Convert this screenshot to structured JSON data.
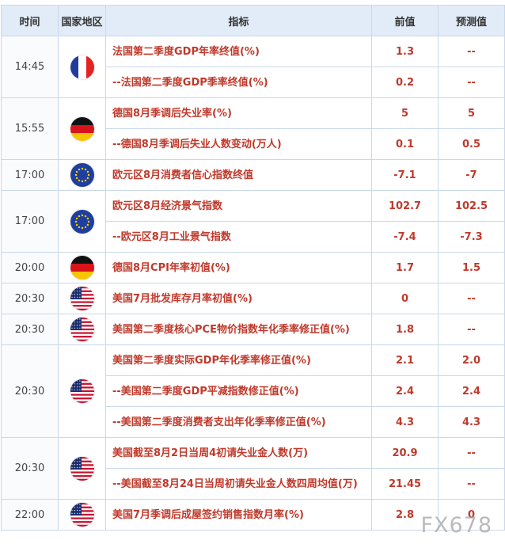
{
  "header": {
    "time": "时间",
    "region": "国家地区",
    "indicator": "指标",
    "prev": "前值",
    "forecast": "预测值"
  },
  "rows": [
    {
      "time": "14:45",
      "flag": "france-flag",
      "items": [
        {
          "name": "法国第二季度GDP年率终值(%)",
          "prev": "1.3",
          "forecast": "--"
        },
        {
          "name": "--法国第二季度GDP季率终值(%)",
          "prev": "0.2",
          "forecast": "--"
        }
      ]
    },
    {
      "time": "15:55",
      "flag": "germany-flag",
      "items": [
        {
          "name": "德国8月季调后失业率(%)",
          "prev": "5",
          "forecast": "5"
        },
        {
          "name": "--德国8月季调后失业人数变动(万人)",
          "prev": "0.1",
          "forecast": "0.5"
        }
      ]
    },
    {
      "time": "17:00",
      "flag": "eu-flag",
      "items": [
        {
          "name": "欧元区8月消费者信心指数终值",
          "prev": "-7.1",
          "forecast": "-7"
        }
      ]
    },
    {
      "time": "17:00",
      "flag": "eu-flag",
      "items": [
        {
          "name": "欧元区8月经济景气指数",
          "prev": "102.7",
          "forecast": "102.5"
        },
        {
          "name": "--欧元区8月工业景气指数",
          "prev": "-7.4",
          "forecast": "-7.3"
        }
      ]
    },
    {
      "time": "20:00",
      "flag": "germany-flag",
      "items": [
        {
          "name": "德国8月CPI年率初值(%)",
          "prev": "1.7",
          "forecast": "1.5"
        }
      ]
    },
    {
      "time": "20:30",
      "flag": "usa-flag",
      "items": [
        {
          "name": "美国7月批发库存月率初值(%)",
          "prev": "0",
          "forecast": "--"
        }
      ]
    },
    {
      "time": "20:30",
      "flag": "usa-flag",
      "items": [
        {
          "name": "美国第二季度核心PCE物价指数年化季率修正值(%)",
          "prev": "1.8",
          "forecast": "--"
        }
      ]
    },
    {
      "time": "20:30",
      "flag": "usa-flag",
      "items": [
        {
          "name": "美国第二季度实际GDP年化季率修正值(%)",
          "prev": "2.1",
          "forecast": "2.0"
        },
        {
          "name": "--美国第二季度GDP平减指数修正值(%)",
          "prev": "2.4",
          "forecast": "2.4"
        },
        {
          "name": "--美国第二季度消费者支出年化季率修正值(%)",
          "prev": "4.3",
          "forecast": "4.3"
        }
      ]
    },
    {
      "time": "20:30",
      "flag": "usa-flag",
      "items": [
        {
          "name": "美国截至8月2日当周4初请失业金人数(万)",
          "prev": "20.9",
          "forecast": "--"
        },
        {
          "name": "--美国截至8月24日当周初请失业金人数四周均值(万)",
          "prev": "21.45",
          "forecast": "--"
        }
      ]
    },
    {
      "time": "22:00",
      "flag": "usa-flag",
      "items": [
        {
          "name": "美国7月季调后成屋签约销售指数月率(%)",
          "prev": "2.8",
          "forecast": "0"
        }
      ]
    }
  ],
  "watermark": "FX678",
  "colors": {
    "header_bg": "#e2ecf8",
    "indicator_text": "#c0392b",
    "border": "#c9d8ea"
  }
}
